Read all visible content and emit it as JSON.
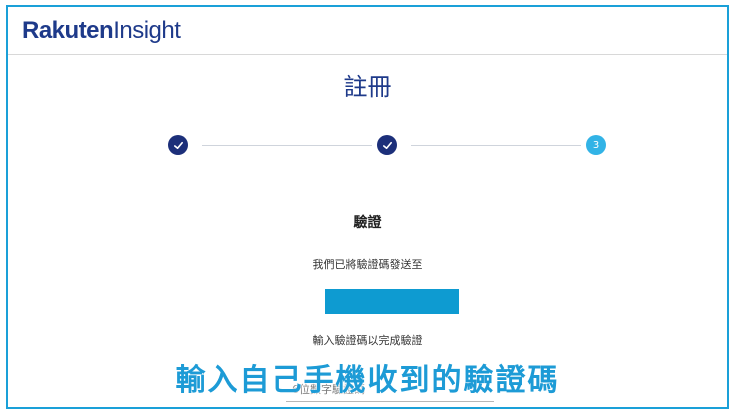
{
  "brand": {
    "logo_main": "Rakuten",
    "logo_sub": "Insight"
  },
  "page": {
    "title": "註冊"
  },
  "steps": [
    {
      "state": "done",
      "label": ""
    },
    {
      "state": "done",
      "label": ""
    },
    {
      "state": "current",
      "label": "3"
    }
  ],
  "verify": {
    "heading": "驗證",
    "sent_text": "我們已將驗證碼發送至",
    "enter_text": "輸入驗證碼以完成驗證",
    "input_placeholder": "6位數字驗證碼"
  },
  "overlay": {
    "caption": "輸入自己手機收到的驗證碼"
  },
  "colors": {
    "brand": "#1e3a8a",
    "step_done": "#1c2f7a",
    "step_current": "#32b3e6",
    "accent": "#1d9bd6",
    "masked": "#0e9bd1",
    "frame": "#1aa0d8"
  }
}
